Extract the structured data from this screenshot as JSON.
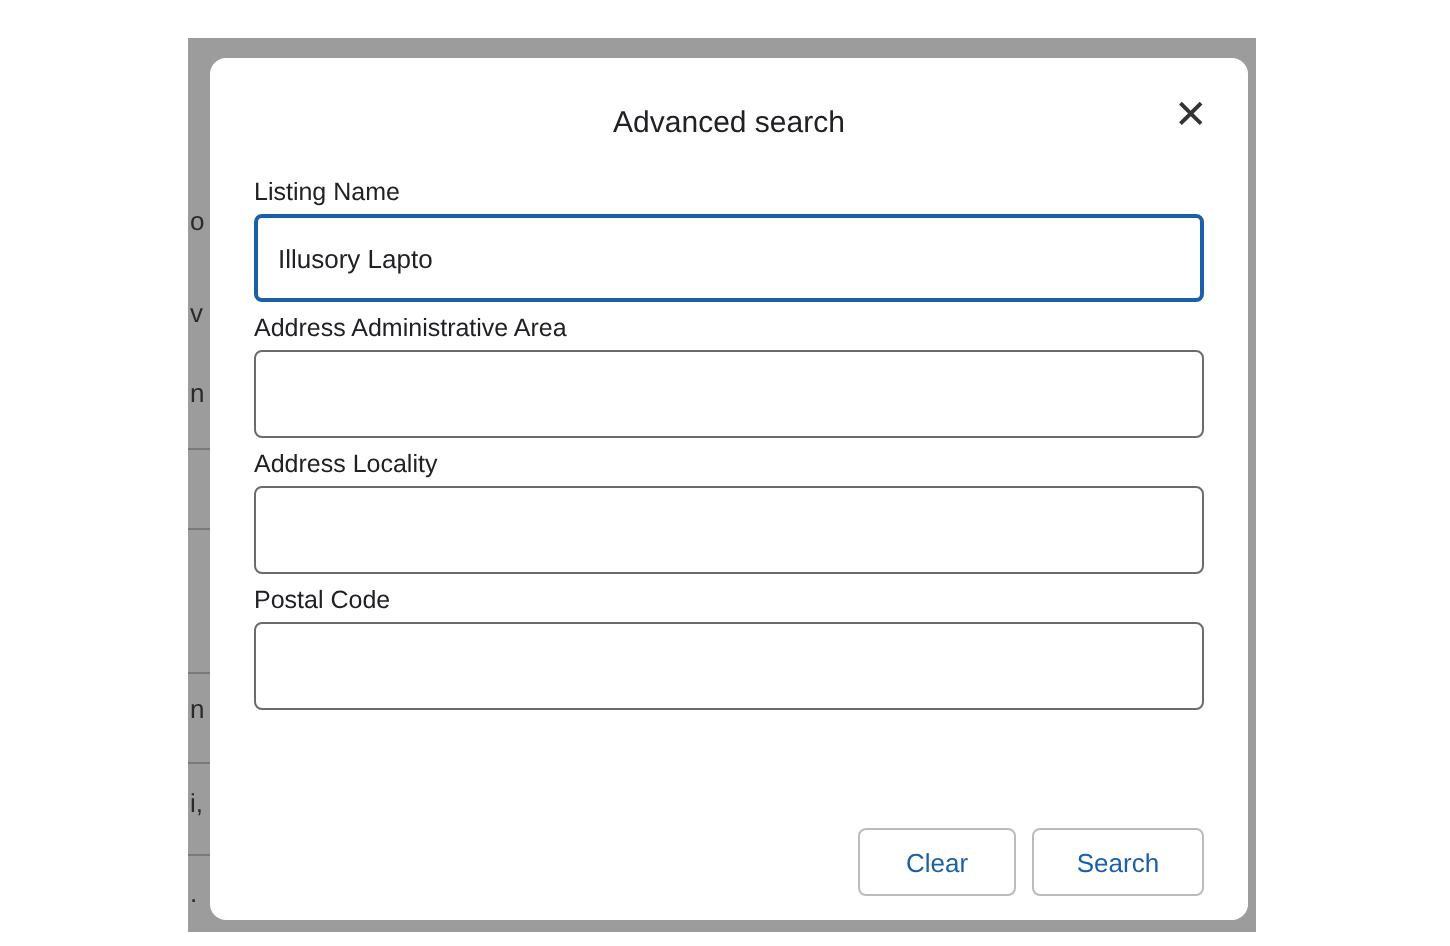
{
  "background": {
    "fragments": [
      "o",
      "v",
      "n",
      "n",
      "i,",
      "."
    ]
  },
  "dialog": {
    "title": "Advanced search",
    "close": "✕",
    "fields": [
      {
        "label": "Listing Name",
        "value": "Illusory Lapto",
        "focused": true
      },
      {
        "label": "Address Administrative Area",
        "focused": false
      },
      {
        "label": "Address Locality",
        "focused": false
      },
      {
        "label": "Postal Code",
        "focused": false
      }
    ],
    "buttons": [
      "Clear",
      "Search"
    ]
  }
}
